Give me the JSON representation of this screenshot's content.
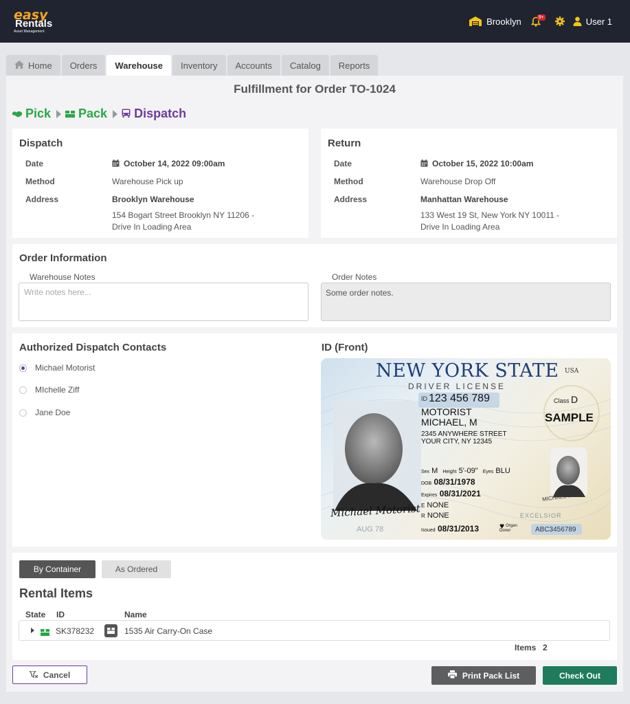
{
  "app": {
    "logo_line1": "easy",
    "logo_line2": "Rentals",
    "logo_line3": "Asset Management",
    "location": "Brooklyn",
    "notification_badge": "9+",
    "user": "User 1"
  },
  "tabs": [
    {
      "label": "Home"
    },
    {
      "label": "Orders"
    },
    {
      "label": "Warehouse"
    },
    {
      "label": "Inventory"
    },
    {
      "label": "Accounts"
    },
    {
      "label": "Catalog"
    },
    {
      "label": "Reports"
    }
  ],
  "active_tab": "Warehouse",
  "page": {
    "title": "Fulfillment for Order TO-1024",
    "steps": [
      "Pick",
      "Pack",
      "Dispatch"
    ]
  },
  "dispatch": {
    "title": "Dispatch",
    "date_label": "Date",
    "date": "October 14, 2022 09:00am",
    "method_label": "Method",
    "method": "Warehouse Pick up",
    "address_label": "Address",
    "address_name": "Brooklyn Warehouse",
    "address_line1": "154 Bogart Street Brooklyn NY 11206 -",
    "address_line2": "Drive In Loading Area"
  },
  "return": {
    "title": "Return",
    "date_label": "Date",
    "date": "October 15, 2022 10:00am",
    "method_label": "Method",
    "method": "Warehouse Drop Off",
    "address_label": "Address",
    "address_name": "Manhattan Warehouse",
    "address_line1": "133 West 19 St, New York NY 10011 -",
    "address_line2": "Drive In Loading Area"
  },
  "order_info": {
    "title": "Order Information",
    "warehouse_notes_label": "Warehouse Notes",
    "warehouse_notes_placeholder": "Write notes here...",
    "order_notes_label": "Order Notes",
    "order_notes": "Some order notes."
  },
  "contacts": {
    "title": "Authorized Dispatch Contacts",
    "items": [
      {
        "name": "Michael Motorist",
        "selected": true
      },
      {
        "name": "MIchelle Ziff",
        "selected": false
      },
      {
        "name": "Jane Doe",
        "selected": false
      }
    ]
  },
  "id_card": {
    "title": "ID (Front)",
    "state": "NEW YORK STATE",
    "usa": "USA",
    "subtitle": "DRIVER LICENSE",
    "id_prefix": "ID",
    "id_number": "123 456 789",
    "class_label": "Class",
    "class_value": "D",
    "sample": "SAMPLE",
    "last_name": "MOTORIST",
    "first_name": "MICHAEL, M",
    "address1": "2345 ANYWHERE STREET",
    "address2": "YOUR CITY, NY  12345",
    "sex_label": "Sex",
    "sex": "M",
    "height_label": "Height",
    "height": "5'-09\"",
    "eyes_label": "Eyes",
    "eyes": "BLU",
    "dob_label": "DOB",
    "dob": "08/31/1978",
    "expires_label": "Expires",
    "expires": "08/31/2021",
    "e_label": "E",
    "e_value": "NONE",
    "r_label": "R",
    "r_value": "NONE",
    "issued_label": "Issued",
    "issued": "08/31/2013",
    "organ_donor": "Organ Donor",
    "doc_number": "ABC3456789",
    "signature": "Michael Motorist",
    "ghost_date": "AUG 78",
    "excelsior": "EXCELSIOR",
    "ghost_name": "MICHAEL M"
  },
  "view_toggle": {
    "by_container": "By Container",
    "as_ordered": "As Ordered"
  },
  "rental_items": {
    "title": "Rental Items",
    "columns": [
      "State",
      "ID",
      "Name"
    ],
    "rows": [
      {
        "id": "SK378232",
        "name": "1535 Air Carry-On Case"
      }
    ],
    "items_label": "Items",
    "items_count": "2"
  },
  "footer": {
    "cancel": "Cancel",
    "print": "Print Pack List",
    "checkout": "Check Out"
  },
  "colors": {
    "topbar": "#1f2430",
    "green": "#27a844",
    "purple": "#6f3b9b",
    "checkout": "#1e7b5c",
    "print": "#5d5e60"
  }
}
